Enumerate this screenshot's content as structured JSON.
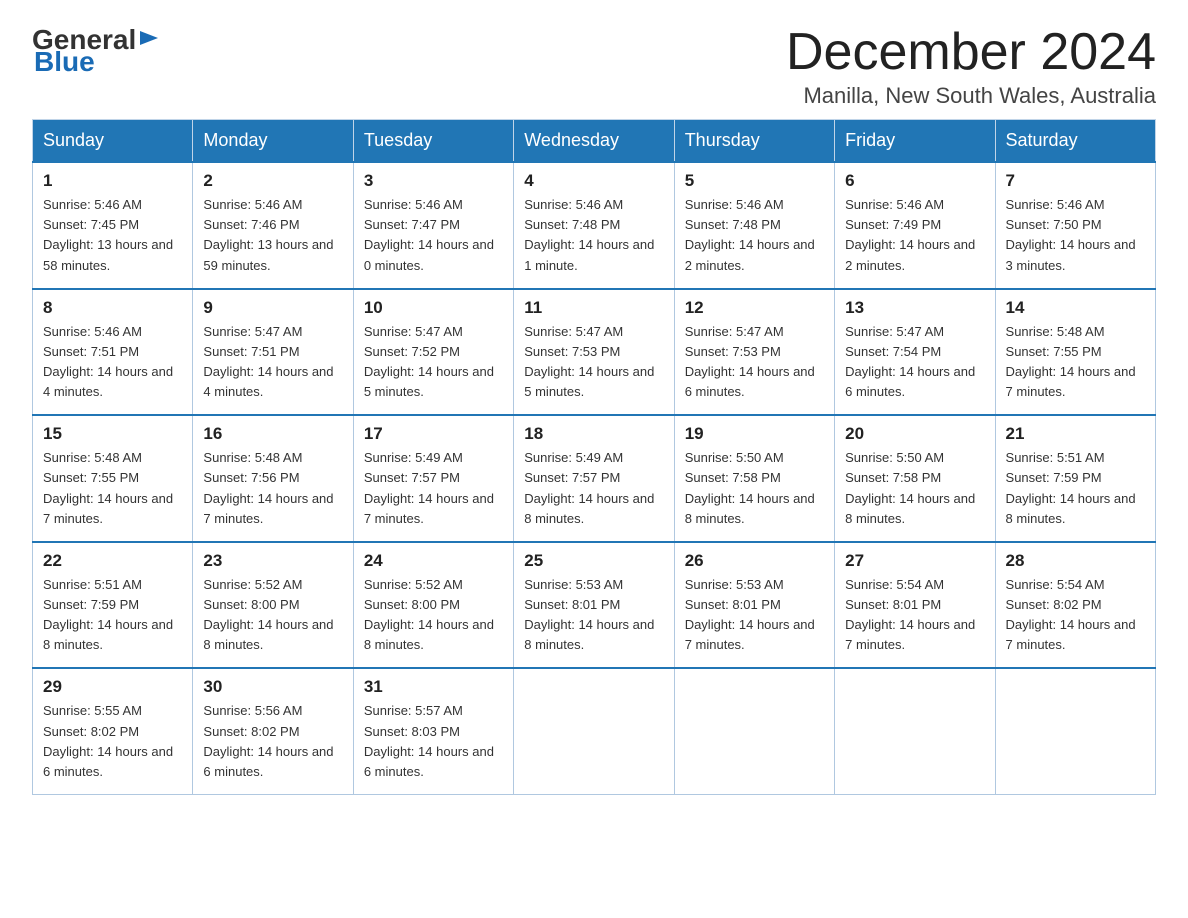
{
  "header": {
    "logo_general": "General",
    "logo_blue": "Blue",
    "month_title": "December 2024",
    "location": "Manilla, New South Wales, Australia"
  },
  "days_of_week": [
    "Sunday",
    "Monday",
    "Tuesday",
    "Wednesday",
    "Thursday",
    "Friday",
    "Saturday"
  ],
  "weeks": [
    [
      {
        "day": "1",
        "sunrise": "5:46 AM",
        "sunset": "7:45 PM",
        "daylight": "13 hours and 58 minutes."
      },
      {
        "day": "2",
        "sunrise": "5:46 AM",
        "sunset": "7:46 PM",
        "daylight": "13 hours and 59 minutes."
      },
      {
        "day": "3",
        "sunrise": "5:46 AM",
        "sunset": "7:47 PM",
        "daylight": "14 hours and 0 minutes."
      },
      {
        "day": "4",
        "sunrise": "5:46 AM",
        "sunset": "7:48 PM",
        "daylight": "14 hours and 1 minute."
      },
      {
        "day": "5",
        "sunrise": "5:46 AM",
        "sunset": "7:48 PM",
        "daylight": "14 hours and 2 minutes."
      },
      {
        "day": "6",
        "sunrise": "5:46 AM",
        "sunset": "7:49 PM",
        "daylight": "14 hours and 2 minutes."
      },
      {
        "day": "7",
        "sunrise": "5:46 AM",
        "sunset": "7:50 PM",
        "daylight": "14 hours and 3 minutes."
      }
    ],
    [
      {
        "day": "8",
        "sunrise": "5:46 AM",
        "sunset": "7:51 PM",
        "daylight": "14 hours and 4 minutes."
      },
      {
        "day": "9",
        "sunrise": "5:47 AM",
        "sunset": "7:51 PM",
        "daylight": "14 hours and 4 minutes."
      },
      {
        "day": "10",
        "sunrise": "5:47 AM",
        "sunset": "7:52 PM",
        "daylight": "14 hours and 5 minutes."
      },
      {
        "day": "11",
        "sunrise": "5:47 AM",
        "sunset": "7:53 PM",
        "daylight": "14 hours and 5 minutes."
      },
      {
        "day": "12",
        "sunrise": "5:47 AM",
        "sunset": "7:53 PM",
        "daylight": "14 hours and 6 minutes."
      },
      {
        "day": "13",
        "sunrise": "5:47 AM",
        "sunset": "7:54 PM",
        "daylight": "14 hours and 6 minutes."
      },
      {
        "day": "14",
        "sunrise": "5:48 AM",
        "sunset": "7:55 PM",
        "daylight": "14 hours and 7 minutes."
      }
    ],
    [
      {
        "day": "15",
        "sunrise": "5:48 AM",
        "sunset": "7:55 PM",
        "daylight": "14 hours and 7 minutes."
      },
      {
        "day": "16",
        "sunrise": "5:48 AM",
        "sunset": "7:56 PM",
        "daylight": "14 hours and 7 minutes."
      },
      {
        "day": "17",
        "sunrise": "5:49 AM",
        "sunset": "7:57 PM",
        "daylight": "14 hours and 7 minutes."
      },
      {
        "day": "18",
        "sunrise": "5:49 AM",
        "sunset": "7:57 PM",
        "daylight": "14 hours and 8 minutes."
      },
      {
        "day": "19",
        "sunrise": "5:50 AM",
        "sunset": "7:58 PM",
        "daylight": "14 hours and 8 minutes."
      },
      {
        "day": "20",
        "sunrise": "5:50 AM",
        "sunset": "7:58 PM",
        "daylight": "14 hours and 8 minutes."
      },
      {
        "day": "21",
        "sunrise": "5:51 AM",
        "sunset": "7:59 PM",
        "daylight": "14 hours and 8 minutes."
      }
    ],
    [
      {
        "day": "22",
        "sunrise": "5:51 AM",
        "sunset": "7:59 PM",
        "daylight": "14 hours and 8 minutes."
      },
      {
        "day": "23",
        "sunrise": "5:52 AM",
        "sunset": "8:00 PM",
        "daylight": "14 hours and 8 minutes."
      },
      {
        "day": "24",
        "sunrise": "5:52 AM",
        "sunset": "8:00 PM",
        "daylight": "14 hours and 8 minutes."
      },
      {
        "day": "25",
        "sunrise": "5:53 AM",
        "sunset": "8:01 PM",
        "daylight": "14 hours and 8 minutes."
      },
      {
        "day": "26",
        "sunrise": "5:53 AM",
        "sunset": "8:01 PM",
        "daylight": "14 hours and 7 minutes."
      },
      {
        "day": "27",
        "sunrise": "5:54 AM",
        "sunset": "8:01 PM",
        "daylight": "14 hours and 7 minutes."
      },
      {
        "day": "28",
        "sunrise": "5:54 AM",
        "sunset": "8:02 PM",
        "daylight": "14 hours and 7 minutes."
      }
    ],
    [
      {
        "day": "29",
        "sunrise": "5:55 AM",
        "sunset": "8:02 PM",
        "daylight": "14 hours and 6 minutes."
      },
      {
        "day": "30",
        "sunrise": "5:56 AM",
        "sunset": "8:02 PM",
        "daylight": "14 hours and 6 minutes."
      },
      {
        "day": "31",
        "sunrise": "5:57 AM",
        "sunset": "8:03 PM",
        "daylight": "14 hours and 6 minutes."
      },
      null,
      null,
      null,
      null
    ]
  ]
}
